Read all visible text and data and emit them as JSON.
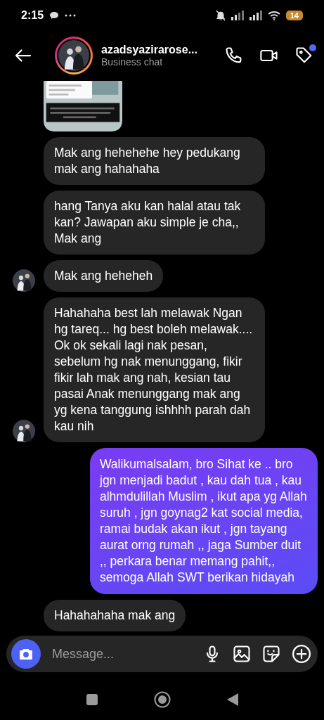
{
  "status_bar": {
    "time": "2:15",
    "battery": "14"
  },
  "header": {
    "name": "azadsyazirarose...",
    "subtitle": "Business chat",
    "tag_unread": true
  },
  "messages": [
    {
      "kind": "picture",
      "outgoing": false,
      "avatar": false
    },
    {
      "kind": "text",
      "outgoing": false,
      "avatar": false,
      "text": "Mak ang hehehehe hey pedukang mak ang hahahaha"
    },
    {
      "kind": "text",
      "outgoing": false,
      "avatar": false,
      "text": "hang Tanya aku kan halal atau tak kan? Jawapan aku simple je cha,, Mak ang"
    },
    {
      "kind": "text",
      "outgoing": false,
      "avatar": true,
      "text": "Mak ang heheheh"
    },
    {
      "kind": "text",
      "outgoing": false,
      "avatar": true,
      "text": "Hahahaha best lah melawak Ngan hg tareq... hg best boleh melawak.... Ok ok sekali lagi nak pesan, sebelum hg nak menunggang, fikir fikir lah mak ang nah, kesian tau pasai Anak menunggang mak ang yg kena tanggung ishhhh parah dah kau nih"
    },
    {
      "kind": "text",
      "outgoing": true,
      "text": "Walikumalsalam, bro Sihat ke .. bro jgn menjadi badut , kau dah tua , kau alhmdulillah Muslim , ikut apa yg Allah suruh , jgn goynag2 kat social media, ramai budak akan ikut , jgn tayang aurat orng rumah ,, jaga Sumber duit ,, perkara benar memang pahit,, semoga Allah SWT berikan hidayah"
    },
    {
      "kind": "text",
      "outgoing": false,
      "avatar": false,
      "text": "Hahahahaha mak ang"
    }
  ],
  "composer": {
    "placeholder": "Message..."
  }
}
